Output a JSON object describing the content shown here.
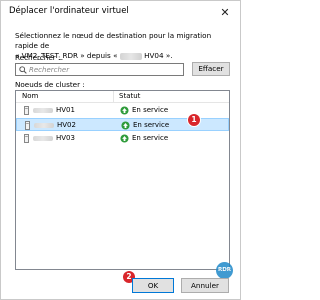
{
  "window": {
    "title": "Déplacer l'ordinateur virtuel",
    "close_glyph": "✕"
  },
  "description": {
    "line1": "Sélectionnez le nœud de destination pour la migration rapide de",
    "line2_prefix": "« VM2_TEST_RDR » depuis «",
    "line2_suffix": "HV04 »."
  },
  "search": {
    "label": "Rechercher :",
    "placeholder": "Rechercher",
    "value": "",
    "icon": "search-icon",
    "clear_label": "Effacer"
  },
  "nodes": {
    "label": "Noeuds de cluster :",
    "columns": {
      "name": "Nom",
      "status": "Statut"
    },
    "rows": [
      {
        "name": "HV01",
        "status": "En service",
        "selected": false
      },
      {
        "name": "HV02",
        "status": "En service",
        "selected": true
      },
      {
        "name": "HV03",
        "status": "En service",
        "selected": false
      }
    ]
  },
  "footer": {
    "ok_label": "OK",
    "cancel_label": "Annuler"
  },
  "annotations": {
    "callout_1": "1",
    "callout_2": "2",
    "watermark": "RDR"
  },
  "colors": {
    "selection_bg": "#cce8ff",
    "status_green": "#2e9b3a",
    "callout_red": "#d9262b",
    "watermark_blue": "#1f89c9"
  }
}
